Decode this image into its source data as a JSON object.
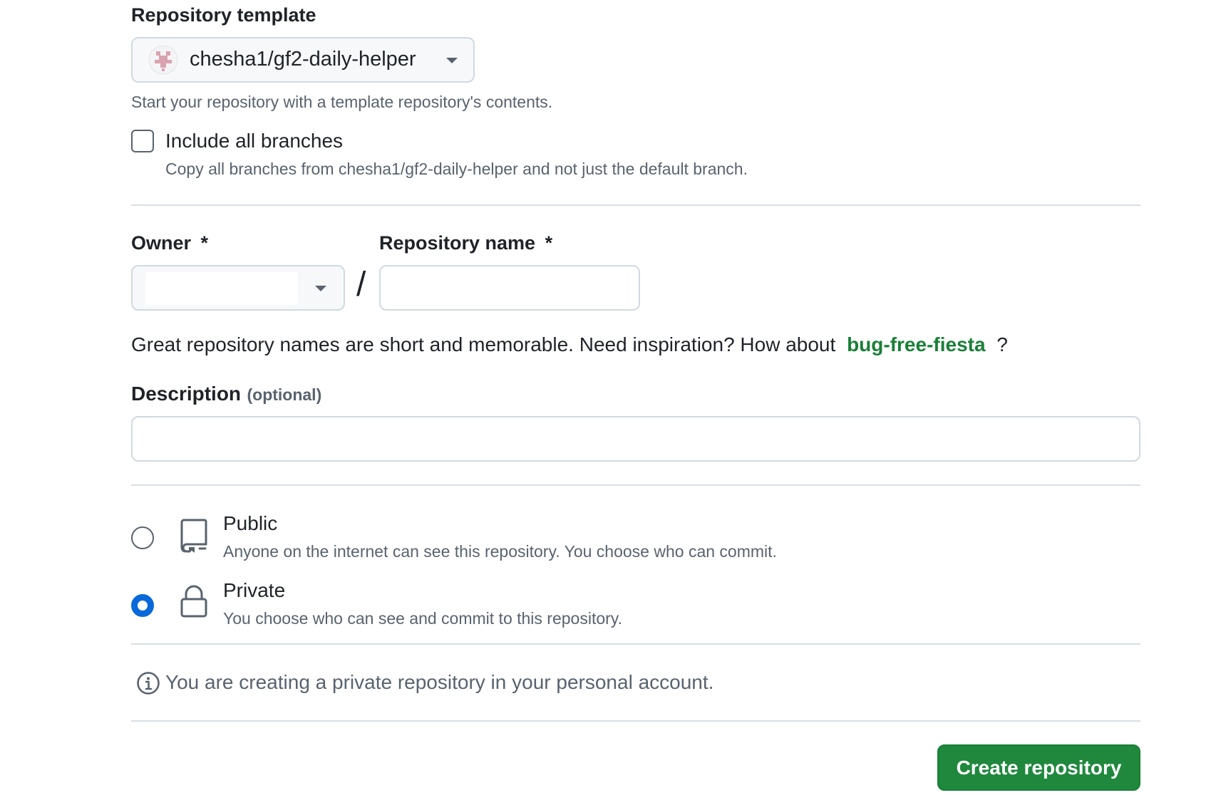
{
  "template": {
    "label": "Repository template",
    "selected": "chesha1/gf2-daily-helper",
    "help": "Start your repository with a template repository's contents.",
    "include_branches_label": "Include all branches",
    "include_branches_desc": "Copy all branches from chesha1/gf2-daily-helper and not just the default branch.",
    "include_branches_checked": false
  },
  "owner": {
    "label": "Owner",
    "required_mark": "*",
    "value": ""
  },
  "separator": "/",
  "repo_name": {
    "label": "Repository name",
    "required_mark": "*",
    "value": ""
  },
  "name_hint": {
    "text": "Great repository names are short and memorable. Need inspiration? How about",
    "suggestion": "bug-free-fiesta",
    "suffix": "?"
  },
  "description": {
    "label": "Description",
    "optional": "(optional)",
    "value": ""
  },
  "visibility": {
    "public": {
      "title": "Public",
      "desc": "Anyone on the internet can see this repository. You choose who can commit.",
      "icon": "repo-icon",
      "selected": false
    },
    "private": {
      "title": "Private",
      "desc": "You choose who can see and commit to this repository.",
      "icon": "lock-icon",
      "selected": true
    }
  },
  "notice": {
    "text": "You are creating a private repository in your personal account.",
    "icon": "info-icon"
  },
  "create_button": "Create repository",
  "colors": {
    "accent": "#0969da",
    "primary_button": "#1f883d",
    "link_green": "#1a7f37"
  }
}
